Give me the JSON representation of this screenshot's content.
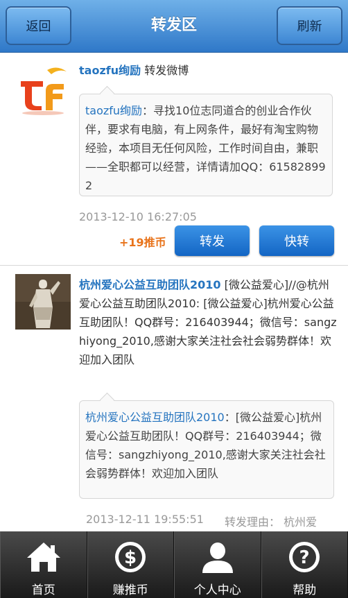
{
  "header": {
    "title": "转发区",
    "back_label": "返回",
    "refresh_label": "刷新"
  },
  "feed": [
    {
      "author": "taozfu绚励",
      "action": "转发微博",
      "quote_author": "taozfu绚励",
      "quote_text": "：寻找10位志同道合的创业合作伙伴，要求有电脑，有上网条件，最好有淘宝购物经验，本项目无任何风险，工作时间自由，兼职——全职都可以经营，详情请加QQ：615828992",
      "time": "2013-12-10 16:27:05",
      "coin": "+19推币",
      "forward_label": "转发",
      "quick_forward_label": "快转"
    },
    {
      "author": "杭州爱心公益互助团队2010",
      "body": " [微公益爱心]//@杭州爱心公益互助团队2010: [微公益爱心]杭州爱心公益互助团队！QQ群号：216403944；微信号：sangzhiyong_2010,感谢大家关注社会社会弱势群体！欢迎加入团队",
      "quote_author": "杭州爱心公益互助团队2010",
      "quote_text": "：[微公益爱心]杭州爱心公益互助团队！QQ群号：216403944；微信号：sangzhiyong_2010,感谢大家关注社会社会弱势群体！欢迎加入团队",
      "time": "2013-12-11 19:55:51",
      "reason": "转发理由：  杭州爱"
    }
  ],
  "tabbar": {
    "items": [
      {
        "label": "首页",
        "icon": "home-icon"
      },
      {
        "label": "赚推币",
        "icon": "dollar-coin-icon"
      },
      {
        "label": "个人中心",
        "icon": "person-icon"
      },
      {
        "label": "帮助",
        "icon": "help-icon"
      }
    ]
  },
  "colors": {
    "header_top": "#6fb0e8",
    "header_bottom": "#2f78c8",
    "link": "#2574bf",
    "coin": "#e8731a",
    "button": "#1f78d4"
  }
}
